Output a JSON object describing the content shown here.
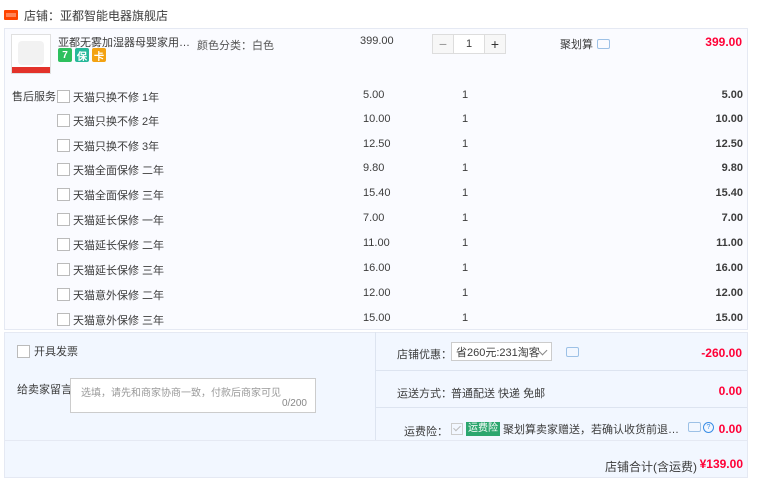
{
  "shop": {
    "icon": "store-icon",
    "name": "店铺：亚都智能电器旗舰店"
  },
  "product": {
    "title": "亚都无雾加湿器母婴家用桌面轻...",
    "sku": "颜色分类：白色",
    "unit_price": "399.00",
    "quantity": "1",
    "promo": "聚划算",
    "total": "399.00",
    "badges": [
      "7",
      "保",
      "卡"
    ]
  },
  "after_sales": {
    "label": "售后服务",
    "items": [
      {
        "name": "天猫只换不修 1年",
        "price": "5.00",
        "qty": "1",
        "subtotal": "5.00"
      },
      {
        "name": "天猫只换不修 2年",
        "price": "10.00",
        "qty": "1",
        "subtotal": "10.00"
      },
      {
        "name": "天猫只换不修 3年",
        "price": "12.50",
        "qty": "1",
        "subtotal": "12.50"
      },
      {
        "name": "天猫全面保修 二年",
        "price": "9.80",
        "qty": "1",
        "subtotal": "9.80"
      },
      {
        "name": "天猫全面保修 三年",
        "price": "15.40",
        "qty": "1",
        "subtotal": "15.40"
      },
      {
        "name": "天猫延长保修 一年",
        "price": "7.00",
        "qty": "1",
        "subtotal": "7.00"
      },
      {
        "name": "天猫延长保修 二年",
        "price": "11.00",
        "qty": "1",
        "subtotal": "11.00"
      },
      {
        "name": "天猫延长保修 三年",
        "price": "16.00",
        "qty": "1",
        "subtotal": "16.00"
      },
      {
        "name": "天猫意外保修 二年",
        "price": "12.00",
        "qty": "1",
        "subtotal": "12.00"
      },
      {
        "name": "天猫意外保修 三年",
        "price": "15.00",
        "qty": "1",
        "subtotal": "15.00"
      }
    ]
  },
  "invoice": {
    "label": "开具发票"
  },
  "message": {
    "label": "给卖家留言：",
    "placeholder": "选填，请先和商家协商一致，付款后商家可见",
    "counter": "0/200"
  },
  "discount": {
    "label": "店铺优惠：",
    "selected": "省260元:231淘客",
    "value": "-260.00"
  },
  "shipping": {
    "label": "运送方式：",
    "method": "普通配送 快递 免邮",
    "value": "0.00"
  },
  "insurance": {
    "label": "运费险：",
    "tag": "运费险",
    "text": "聚划算卖家赠送，若确认收货前退货，可获...",
    "value": "0.00"
  },
  "store_total": {
    "label": "店铺合计(含运费)",
    "value": "¥139.00"
  },
  "colors": {
    "accent": "#ff0036",
    "shop_red": "#ff4400",
    "panel_bg": "#f2f7ff"
  }
}
